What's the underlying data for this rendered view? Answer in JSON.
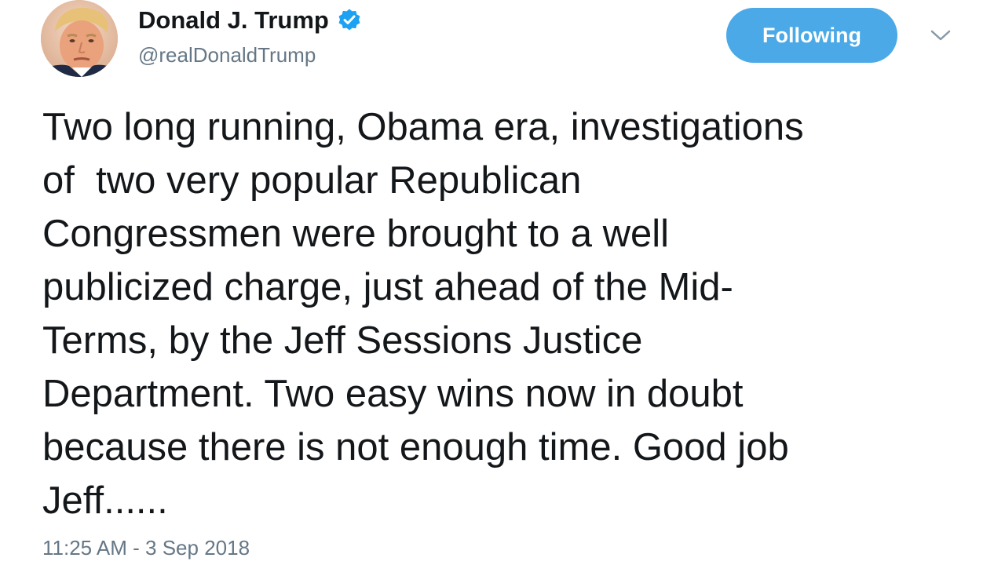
{
  "author": {
    "display_name": "Donald J. Trump",
    "handle": "@realDonaldTrump",
    "verified": true,
    "avatar_icon": "profile-photo"
  },
  "follow_button": {
    "label": "Following"
  },
  "menu_icon": "chevron-down-icon",
  "tweet": {
    "lines": [
      "Two long running, Obama era, investigations",
      "of  two very popular Republican",
      "Congressmen were brought to a well",
      "publicized charge, just ahead of the Mid-",
      "Terms, by the Jeff Sessions Justice",
      "Department. Two easy wins now in doubt",
      "because there is not enough time. Good job",
      "Jeff......"
    ],
    "timestamp": "11:25 AM - 3 Sep 2018"
  },
  "colors": {
    "follow_button_bg": "#4aa9e6",
    "verified_badge": "#1da1f2",
    "secondary_text": "#657786",
    "primary_text": "#14171a"
  }
}
